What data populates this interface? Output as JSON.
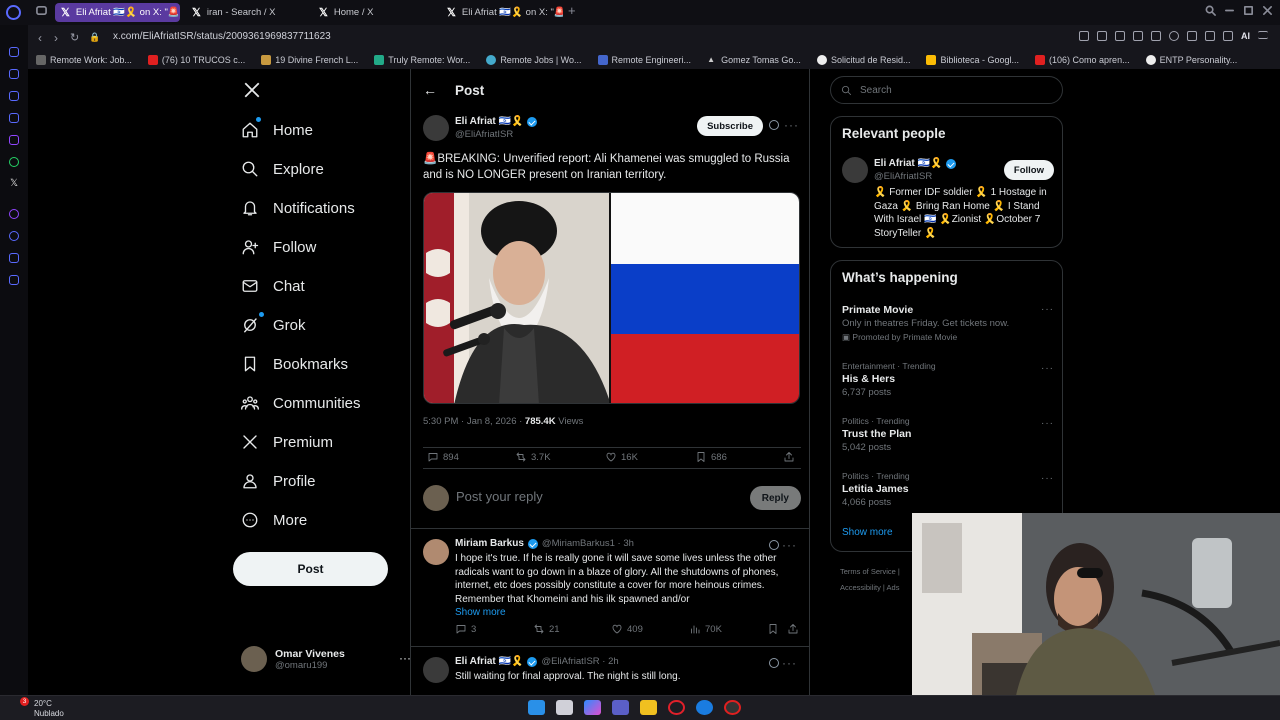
{
  "browser": {
    "tabs": [
      {
        "title": "Eli Afriat 🇮🇱🎗️ on X: \"🚨BR"
      },
      {
        "title": "iran - Search / X"
      },
      {
        "title": "Home / X"
      },
      {
        "title": "Eli Afriat 🇮🇱🎗️ on X: \"🚨BR"
      }
    ],
    "url": "x.com/EliAfriatISR/status/2009361969837711623",
    "bookmarks": [
      "Remote Work: Job...",
      "(76) 10 TRUCOS c...",
      "19 Divine French L...",
      "Truly Remote: Wor...",
      "Remote Jobs | Wo...",
      "Remote Engineeri...",
      "Gomez Tomas Go...",
      "Solicitud de Resid...",
      "Biblioteca - Googl...",
      "(106) Como apren...",
      "ENTP Personality..."
    ],
    "ai_label": "AI"
  },
  "nav": {
    "items": [
      "Home",
      "Explore",
      "Notifications",
      "Follow",
      "Chat",
      "Grok",
      "Bookmarks",
      "Communities",
      "Premium",
      "Profile",
      "More"
    ],
    "post_button": "Post",
    "account_name": "Omar Vivenes",
    "account_handle": "@omaru199"
  },
  "post": {
    "header": "Post",
    "author_name": "Eli Afriat 🇮🇱🎗️",
    "author_handle": "@EliAfriatISR",
    "subscribe": "Subscribe",
    "text": "🚨BREAKING: Unverified report: Ali Khamenei was smuggled to Russia and is NO LONGER present on Iranian territory.",
    "time": "5:30 PM · Jan 8, 2026 · ",
    "views_count": "785.4K",
    "views_label": " Views",
    "replies": "894",
    "reposts": "3.7K",
    "likes": "16K",
    "bookmarks": "686",
    "reply_placeholder": "Post your reply",
    "reply_button": "Reply"
  },
  "replies": [
    {
      "name": "Miriam Barkus",
      "handle": "@MiriamBarkus1 · 3h",
      "text": "I hope it's true. If he is really gone it will save some lives unless the other radicals want to go down in a blaze of glory.  All the shutdowns of phones, internet, etc does possibly constitute a cover for more heinous crimes. Remember that Khomeini and his ilk spawned and/or",
      "show_more": "Show more",
      "replies": "3",
      "reposts": "21",
      "likes": "409",
      "views": "70K"
    },
    {
      "name": "Eli Afriat 🇮🇱🎗️",
      "handle": "@EliAfriatISR · 2h",
      "text": "Still waiting for final approval. The night is still long."
    }
  ],
  "right": {
    "search_placeholder": "Search",
    "relevant_title": "Relevant people",
    "rp_name": "Eli Afriat 🇮🇱🎗️",
    "rp_handle": "@EliAfriatISR",
    "follow": "Follow",
    "rp_bio": "🎗️ Former IDF soldier 🎗️ 1 Hostage in Gaza 🎗️ Bring Ran Home 🎗️ I Stand With Israel 🇮🇱 🎗️Zionist 🎗️October 7 StoryTeller 🎗️",
    "happening_title": "What’s happening",
    "trends": [
      {
        "context": "",
        "title": "Primate Movie",
        "sub": "Only in theatres Friday. Get tickets now.",
        "promo": "Promoted by Primate Movie"
      },
      {
        "context": "Entertainment · Trending",
        "title": "His & Hers",
        "sub": "6,737 posts"
      },
      {
        "context": "Politics · Trending",
        "title": "Trust the Plan",
        "sub": "5,042 posts"
      },
      {
        "context": "Politics · Trending",
        "title": "Letitia James",
        "sub": "4,066 posts"
      }
    ],
    "show_more": "Show more",
    "footer_1": "Terms of Service  |",
    "footer_2": "Accessibility  |  Ads"
  },
  "taskbar": {
    "temp": "20°C",
    "weather": "Nublado",
    "badge": "3"
  },
  "colors": {
    "accent": "#1d9bf0",
    "background": "#000000",
    "border": "#2f3336",
    "muted": "#71767b",
    "active_tab": "#5a3aa0"
  },
  "icons": [
    "x-logo-icon",
    "home-icon",
    "search-icon",
    "bell-icon",
    "follow-icon",
    "mail-icon",
    "grok-icon",
    "bookmark-icon",
    "communities-icon",
    "premium-icon",
    "profile-icon",
    "more-icon",
    "back-arrow-icon",
    "reply-icon",
    "repost-icon",
    "like-icon",
    "share-icon",
    "views-icon"
  ]
}
